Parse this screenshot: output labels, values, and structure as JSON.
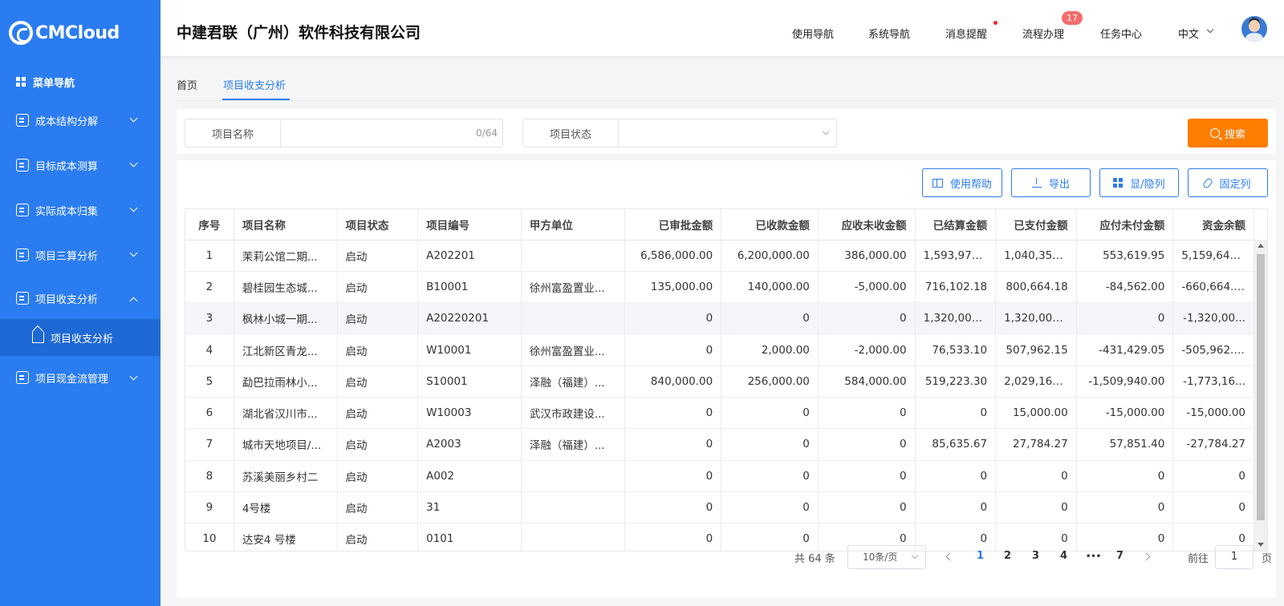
{
  "brand": {
    "logo_text": "CMCloud"
  },
  "sidebar": {
    "menu_title": "菜单导航",
    "items": [
      {
        "label": "成本结构分解",
        "icon": "building-icon"
      },
      {
        "label": "目标成本测算",
        "icon": "database-icon"
      },
      {
        "label": "实际成本归集",
        "icon": "chart-doc-icon"
      },
      {
        "label": "项目三算分析",
        "icon": "document-icon"
      },
      {
        "label": "项目收支分析",
        "icon": "wallet-icon",
        "expanded": true
      },
      {
        "label": "项目现金流管理",
        "icon": "database-icon"
      }
    ],
    "sub_item": {
      "label": "项目收支分析",
      "icon": "home-icon"
    }
  },
  "header": {
    "company": "中建君联（广州）软件科技有限公司",
    "nav": [
      "使用导航",
      "系统导航",
      "消息提醒",
      "流程办理",
      "任务中心"
    ],
    "badge": "17",
    "language": "中文"
  },
  "tabs": [
    {
      "label": "首页"
    },
    {
      "label": "项目收支分析",
      "active": true
    }
  ],
  "search": {
    "name_label": "项目名称",
    "name_counter": "0/64",
    "status_label": "项目状态",
    "button": "搜索"
  },
  "toolbar": {
    "help": "使用帮助",
    "export": "导出",
    "toggle_columns": "显/隐列",
    "fix_columns": "固定列"
  },
  "table": {
    "headers": [
      "序号",
      "项目名称",
      "项目状态",
      "项目编号",
      "甲方单位",
      "已审批金额",
      "已收款金额",
      "应收未收金额",
      "已结算金额",
      "已支付金额",
      "应付未付金额",
      "资金余额"
    ],
    "rows": [
      [
        "1",
        "茉莉公馆二期...",
        "启动",
        "A202201",
        "",
        "6,586,000.00",
        "6,200,000.00",
        "386,000.00",
        "1,593,975....",
        "1,040,356....",
        "553,619.95",
        "5,159,644...."
      ],
      [
        "2",
        "碧桂园生态城...",
        "启动",
        "B10001",
        "徐州富盈置业...",
        "135,000.00",
        "140,000.00",
        "-5,000.00",
        "716,102.18",
        "800,664.18",
        "-84,562.00",
        "-660,664.18"
      ],
      [
        "3",
        "枫林小城一期...",
        "启动",
        "A20220201",
        "",
        "0",
        "0",
        "0",
        "1,320,000....",
        "1,320,000....",
        "0",
        "-1,320,00..."
      ],
      [
        "4",
        "江北新区青龙...",
        "启动",
        "W10001",
        "徐州富盈置业...",
        "0",
        "2,000.00",
        "-2,000.00",
        "76,533.10",
        "507,962.15",
        "-431,429.05",
        "-505,962.15"
      ],
      [
        "5",
        "勐巴拉雨林小...",
        "启动",
        "S10001",
        "泽融（福建）...",
        "840,000.00",
        "256,000.00",
        "584,000.00",
        "519,223.30",
        "2,029,163....",
        "-1,509,940.00",
        "-1,773,16..."
      ],
      [
        "6",
        "湖北省汉川市...",
        "启动",
        "W10003",
        "武汉市政建设...",
        "0",
        "0",
        "0",
        "0",
        "15,000.00",
        "-15,000.00",
        "-15,000.00"
      ],
      [
        "7",
        "城市天地项目/...",
        "启动",
        "A2003",
        "泽融（福建）...",
        "0",
        "0",
        "0",
        "85,635.67",
        "27,784.27",
        "57,851.40",
        "-27,784.27"
      ],
      [
        "8",
        "苏溪美丽乡村二",
        "启动",
        "A002",
        "",
        "0",
        "0",
        "0",
        "0",
        "0",
        "0",
        "0"
      ],
      [
        "9",
        "4号楼",
        "启动",
        "31",
        "",
        "0",
        "0",
        "0",
        "0",
        "0",
        "0",
        "0"
      ],
      [
        "10",
        "达安4 号楼",
        "启动",
        "0101",
        "",
        "0",
        "0",
        "0",
        "0",
        "0",
        "0",
        "0"
      ]
    ],
    "highlight_row": 3
  },
  "pagination": {
    "total": "共 64 条",
    "page_size": "10条/页",
    "pages": [
      "1",
      "2",
      "3",
      "4",
      "•••",
      "7"
    ],
    "current": "1",
    "goto_label": "前往",
    "goto_value": "1",
    "goto_unit": "页"
  }
}
